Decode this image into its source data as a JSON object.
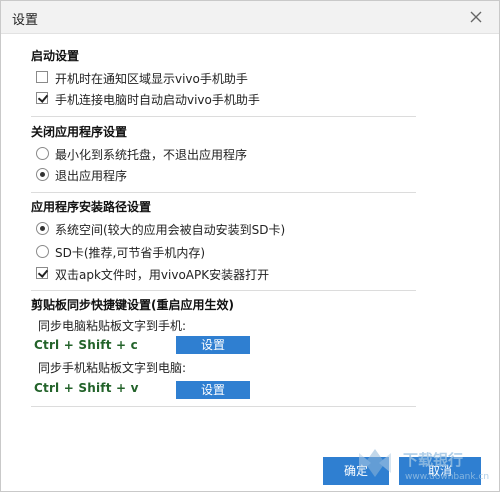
{
  "dialog": {
    "title": "设置",
    "close_icon": "close-icon"
  },
  "startup": {
    "title": "启动设置",
    "options": [
      {
        "label": "开机时在通知区域显示vivo手机助手",
        "checked": false
      },
      {
        "label": "手机连接电脑时自动启动vivo手机助手",
        "checked": true
      }
    ]
  },
  "close_app": {
    "title": "关闭应用程序设置",
    "options": [
      {
        "label": "最小化到系统托盘，不退出应用程序",
        "selected": false
      },
      {
        "label": "退出应用程序",
        "selected": true
      }
    ]
  },
  "install_path": {
    "title": "应用程序安装路径设置",
    "options": [
      {
        "label": "系统空间(较大的应用会被自动安装到SD卡)",
        "selected": true
      },
      {
        "label": "SD卡(推荐,可节省手机内存)",
        "selected": false
      }
    ],
    "apk_option": {
      "label": "双击apk文件时，用vivoAPK安装器打开",
      "checked": true
    }
  },
  "clipboard": {
    "title": "剪贴板同步快捷键设置(重启应用生效)",
    "items": [
      {
        "label": "同步电脑粘贴板文字到手机:",
        "hotkey": "Ctrl + Shift + c",
        "button": "设置"
      },
      {
        "label": "同步手机粘贴板文字到电脑:",
        "hotkey": "Ctrl + Shift + v",
        "button": "设置"
      }
    ]
  },
  "footer": {
    "ok_label": "确定",
    "cancel_label": "取消"
  },
  "watermark": {
    "text": "下载银行",
    "subtext": "www.downbank.cn"
  },
  "colors": {
    "accent": "#2f7fd1",
    "hotkey": "#23632a"
  }
}
